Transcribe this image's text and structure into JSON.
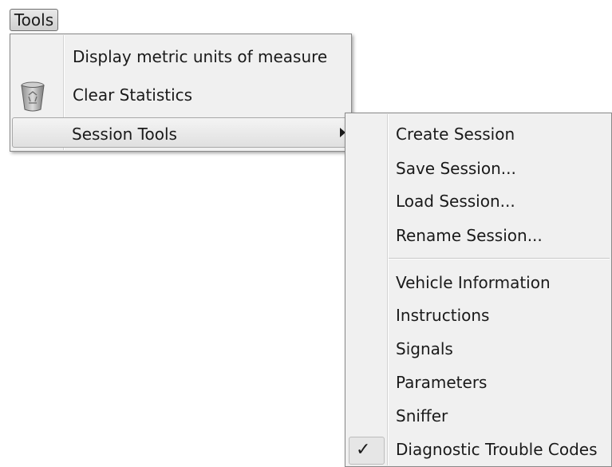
{
  "menubar": {
    "tools_label": "Tools"
  },
  "tools_menu": {
    "items": [
      {
        "label": "Display metric units of measure",
        "icon": null
      },
      {
        "label": "Clear Statistics",
        "icon": "recycle-bin-icon"
      },
      {
        "label": "Session Tools",
        "icon": null,
        "submenu": true
      }
    ]
  },
  "session_tools_menu": {
    "group1": [
      {
        "label": "Create Session"
      },
      {
        "label": "Save Session..."
      },
      {
        "label": "Load Session..."
      },
      {
        "label": "Rename Session..."
      }
    ],
    "group2": [
      {
        "label": "Vehicle Information",
        "checked": false
      },
      {
        "label": "Instructions",
        "checked": false
      },
      {
        "label": "Signals",
        "checked": false
      },
      {
        "label": "Parameters",
        "checked": false
      },
      {
        "label": "Sniffer",
        "checked": false
      },
      {
        "label": "Diagnostic Trouble Codes",
        "checked": true,
        "check_glyph": "✓"
      }
    ]
  }
}
